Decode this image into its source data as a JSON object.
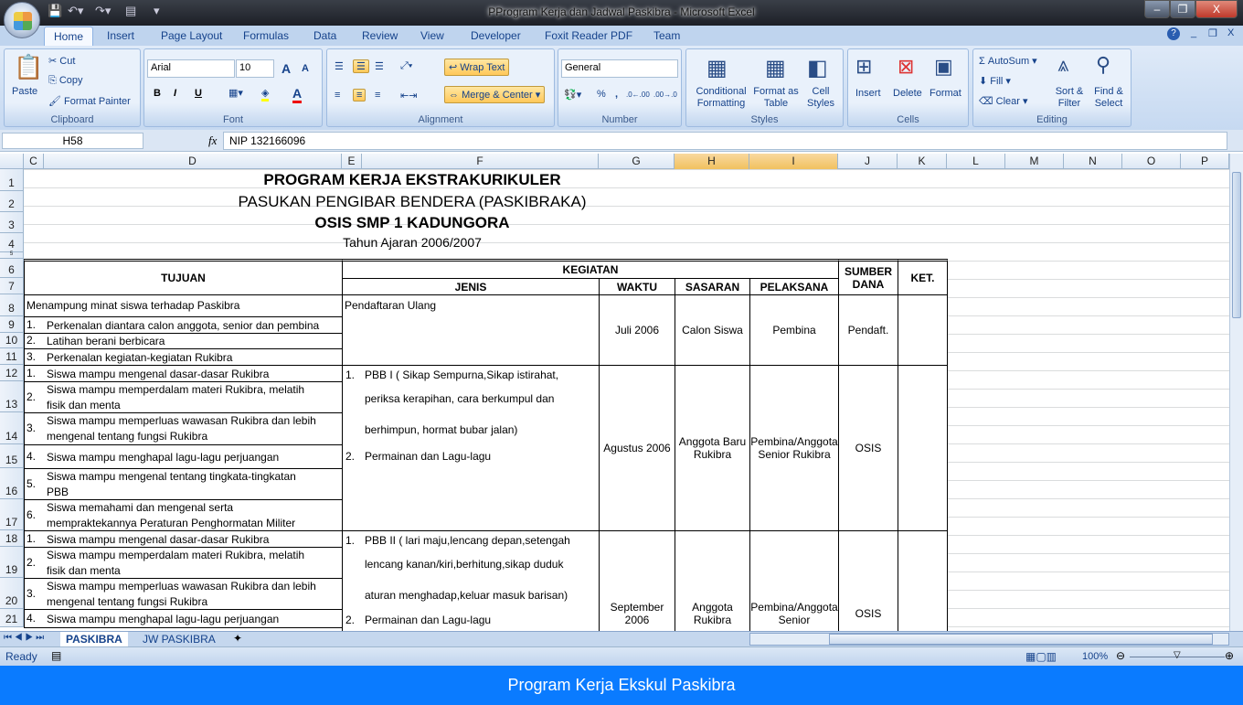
{
  "window": {
    "title": "PProgram Kerja dan Jadwal Paskibra - Microsoft Excel",
    "minimize": "–",
    "restore": "❐",
    "close": "X"
  },
  "ribbon_tabs": [
    "Home",
    "Insert",
    "Page Layout",
    "Formulas",
    "Data",
    "Review",
    "View",
    "Developer",
    "Foxit Reader PDF",
    "Team"
  ],
  "clipboard": {
    "paste": "Paste",
    "cut": "Cut",
    "copy": "Copy",
    "format_painter": "Format Painter",
    "label": "Clipboard"
  },
  "font": {
    "name": "Arial",
    "size": "10",
    "bold": "B",
    "italic": "I",
    "underline": "U",
    "label": "Font",
    "grow": "A",
    "shrink": "A"
  },
  "alignment": {
    "wrap_text": "Wrap Text",
    "merge_center": "Merge & Center",
    "label": "Alignment"
  },
  "number": {
    "format": "General",
    "percent": "%",
    "comma": ",",
    "inc_decimal": ".0←.00",
    "dec_decimal": ".00→.0",
    "label": "Number"
  },
  "styles": {
    "conditional": "Conditional Formatting",
    "format_table": "Format as Table",
    "cell_styles": "Cell Styles",
    "label": "Styles"
  },
  "cells": {
    "insert": "Insert",
    "delete": "Delete",
    "format": "Format",
    "label": "Cells"
  },
  "editing": {
    "autosum": "AutoSum",
    "fill": "Fill",
    "clear": "Clear",
    "sort": "Sort & Filter",
    "find": "Find & Select",
    "label": "Editing"
  },
  "formula_bar": {
    "name_box": "H58",
    "fx": "fx",
    "value": "NIP 132166096"
  },
  "columns": [
    "C",
    "D",
    "E",
    "F",
    "G",
    "H",
    "I",
    "J",
    "K",
    "L",
    "M",
    "N",
    "O",
    "P"
  ],
  "selected_columns": [
    "H",
    "I"
  ],
  "rows": [
    "1",
    "2",
    "3",
    "4",
    "5",
    "6",
    "7",
    "8",
    "9",
    "10",
    "11",
    "12",
    "13",
    "14",
    "15",
    "16",
    "17",
    "18",
    "19",
    "20",
    "21"
  ],
  "sheet": {
    "title1": "PROGRAM KERJA EKSTRAKURIKULER",
    "title2": "PASUKAN PENGIBAR BENDERA (PASKIBRAKA)",
    "title3": "OSIS SMP 1 KADUNGORA",
    "title4": "Tahun Ajaran 2006/2007",
    "headers": {
      "tujuan": "TUJUAN",
      "kegiatan": "KEGIATAN",
      "jenis": "JENIS",
      "waktu": "WAKTU",
      "sasaran": "SASARAN",
      "pelaksana": "PELAKSANA",
      "sumber_dana": "SUMBER DANA",
      "ket": "KET."
    },
    "blocks": [
      {
        "tujuan_intro": "Menampung minat siswa terhadap Paskibra",
        "tujuan": [
          {
            "n": "1.",
            "t": [
              "Perkenalan diantara calon anggota, senior dan pembina"
            ]
          },
          {
            "n": "2.",
            "t": [
              "Latihan berani berbicara"
            ]
          },
          {
            "n": "3.",
            "t": [
              "Perkenalan kegiatan-kegiatan Rukibra"
            ]
          }
        ],
        "jenis": [
          {
            "n": "",
            "t": "Pendaftaran Ulang"
          }
        ],
        "waktu": "Juli 2006",
        "sasaran": "Calon Siswa",
        "pelaksana": "Pembina",
        "sumber_dana": "Pendaft.",
        "ket": ""
      },
      {
        "tujuan": [
          {
            "n": "1.",
            "t": [
              "Siswa mampu mengenal dasar-dasar Rukibra"
            ]
          },
          {
            "n": "2.",
            "t": [
              "Siswa mampu memperdalam materi Rukibra, melatih",
              "fisik dan menta"
            ]
          },
          {
            "n": "3.",
            "t": [
              "Siswa mampu memperluas wawasan Rukibra dan lebih",
              "mengenal tentang fungsi Rukibra"
            ]
          },
          {
            "n": "4.",
            "t": [
              "Siswa mampu menghapal lagu-lagu perjuangan"
            ]
          },
          {
            "n": "5.",
            "t": [
              "Siswa mampu mengenal tentang tingkata-tingkatan",
              "PBB"
            ]
          },
          {
            "n": "6.",
            "t": [
              "Siswa memahami dan mengenal serta",
              "mempraktekannya Peraturan Penghormatan Militer"
            ]
          }
        ],
        "jenis": [
          {
            "n": "1.",
            "t": "PBB  I ( Sikap Sempurna,Sikap istirahat,"
          },
          {
            "n": "",
            "t": "periksa kerapihan, cara berkumpul dan"
          },
          {
            "n": "",
            "t": "berhimpun, hormat bubar jalan)"
          },
          {
            "n": "2.",
            "t": "Permainan dan Lagu-lagu"
          }
        ],
        "waktu": "Agustus 2006",
        "sasaran": "Anggota Baru Rukibra",
        "pelaksana": "Pembina/Anggota Senior Rukibra",
        "sumber_dana": "OSIS",
        "ket": ""
      },
      {
        "tujuan": [
          {
            "n": "1.",
            "t": [
              "Siswa mampu mengenal dasar-dasar Rukibra"
            ]
          },
          {
            "n": "2.",
            "t": [
              "Siswa mampu memperdalam materi Rukibra, melatih",
              "fisik dan menta"
            ]
          },
          {
            "n": "3.",
            "t": [
              "Siswa mampu memperluas wawasan Rukibra dan lebih",
              "mengenal tentang fungsi Rukibra"
            ]
          },
          {
            "n": "4.",
            "t": [
              "Siswa mampu menghapal lagu-lagu perjuangan"
            ]
          }
        ],
        "jenis": [
          {
            "n": "1.",
            "t": "PBB II ( lari maju,lencang depan,setengah"
          },
          {
            "n": "",
            "t": "lencang kanan/kiri,berhitung,sikap duduk"
          },
          {
            "n": "",
            "t": "aturan menghadap,keluar masuk barisan)"
          },
          {
            "n": "2.",
            "t": "Permainan dan Lagu-lagu"
          }
        ],
        "waktu": "September 2006",
        "sasaran": "Anggota Rukibra",
        "pelaksana": "Pembina/Anggota Senior",
        "sumber_dana": "OSIS",
        "ket": ""
      }
    ]
  },
  "sheet_tabs": [
    "PASKIBRA",
    "JW PASKIBRA"
  ],
  "active_sheet": "PASKIBRA",
  "status": {
    "ready": "Ready",
    "zoom": "100%"
  },
  "zoom_level": 100,
  "caption": "Program Kerja Ekskul Paskibra"
}
